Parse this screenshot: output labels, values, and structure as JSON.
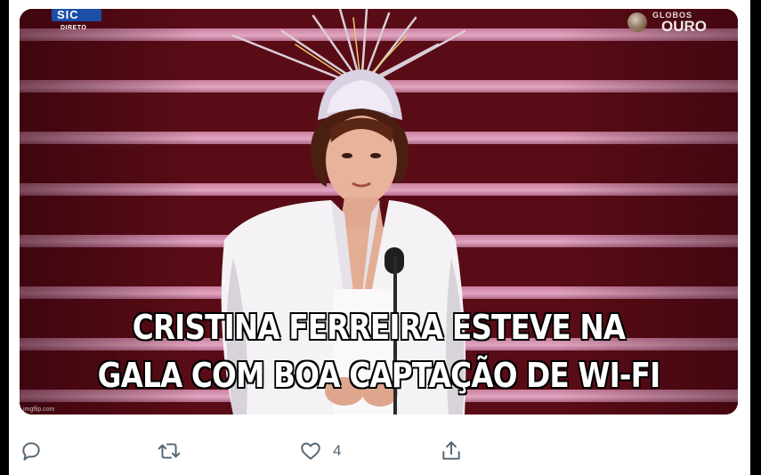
{
  "media": {
    "broadcaster_logo": "SIC",
    "broadcaster_live": "DIRETO",
    "event_logo_line1": "GLOBOS",
    "event_logo_line2": "OURO",
    "caption_line1": "CRISTINA FERREIRA ESTEVE NA",
    "caption_line2": "GALA COM BOA CAPTAÇÃO DE WI-FI",
    "watermark": "imgflip.com"
  },
  "actions": {
    "reply": {
      "icon": "reply-icon",
      "count": ""
    },
    "retweet": {
      "icon": "retweet-icon",
      "count": ""
    },
    "like": {
      "icon": "heart-icon",
      "count": "4"
    },
    "share": {
      "icon": "share-icon",
      "count": ""
    }
  },
  "colors": {
    "icon_gray": "#536471",
    "background": "#ffffff",
    "frame": "#000000"
  }
}
